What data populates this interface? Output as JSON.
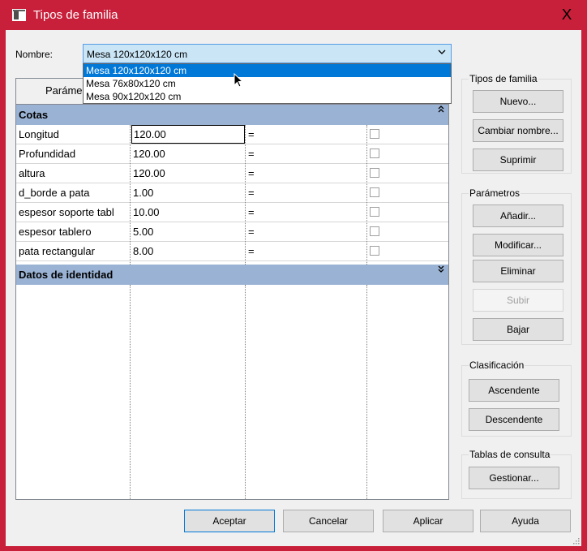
{
  "window": {
    "title": "Tipos de familia",
    "close_glyph": "X"
  },
  "nombre": {
    "label": "Nombre:",
    "selected": "Mesa 120x120x120 cm",
    "options": [
      "Mesa 120x120x120 cm",
      "Mesa 76x80x120 cm",
      "Mesa 90x120x120 cm"
    ]
  },
  "grid": {
    "tab_label": "Paráme",
    "sections": [
      {
        "label": "Cotas",
        "chevron": "⌃",
        "rows": [
          {
            "name": "Longitud",
            "value": "120.00",
            "formula": "=",
            "locked": false
          },
          {
            "name": "Profundidad",
            "value": "120.00",
            "formula": "=",
            "locked": false
          },
          {
            "name": "altura",
            "value": "120.00",
            "formula": "=",
            "locked": false
          },
          {
            "name": "d_borde a pata",
            "value": "1.00",
            "formula": "=",
            "locked": false
          },
          {
            "name": "espesor soporte tabl",
            "value": "10.00",
            "formula": "=",
            "locked": false
          },
          {
            "name": "espesor tablero",
            "value": "5.00",
            "formula": "=",
            "locked": false
          },
          {
            "name": "pata rectangular",
            "value": "8.00",
            "formula": "=",
            "locked": false
          }
        ]
      },
      {
        "label": "Datos de identidad",
        "chevron": "⌄",
        "rows": []
      }
    ]
  },
  "tipos_de_familia": {
    "title": "Tipos de familia",
    "buttons": [
      "Nuevo...",
      "Cambiar nombre...",
      "Suprimir"
    ]
  },
  "parametros": {
    "title": "Parámetros",
    "buttons": [
      "Añadir...",
      "Modificar...",
      "Eliminar",
      "Subir",
      "Bajar"
    ],
    "disabled": [
      "Subir"
    ]
  },
  "clasificacion": {
    "title": "Clasificación",
    "buttons": [
      "Ascendente",
      "Descendente"
    ]
  },
  "tablas_de_consulta": {
    "title": "Tablas de consulta",
    "buttons": [
      "Gestionar..."
    ]
  },
  "footer": {
    "buttons": [
      "Aceptar",
      "Cancelar",
      "Aplicar",
      "Ayuda"
    ]
  },
  "colors": {
    "title_bar": "#c8203a",
    "section_header": "#9ab3d5",
    "selection": "#0078d7",
    "combo_highlight": "#c9e5f6"
  }
}
